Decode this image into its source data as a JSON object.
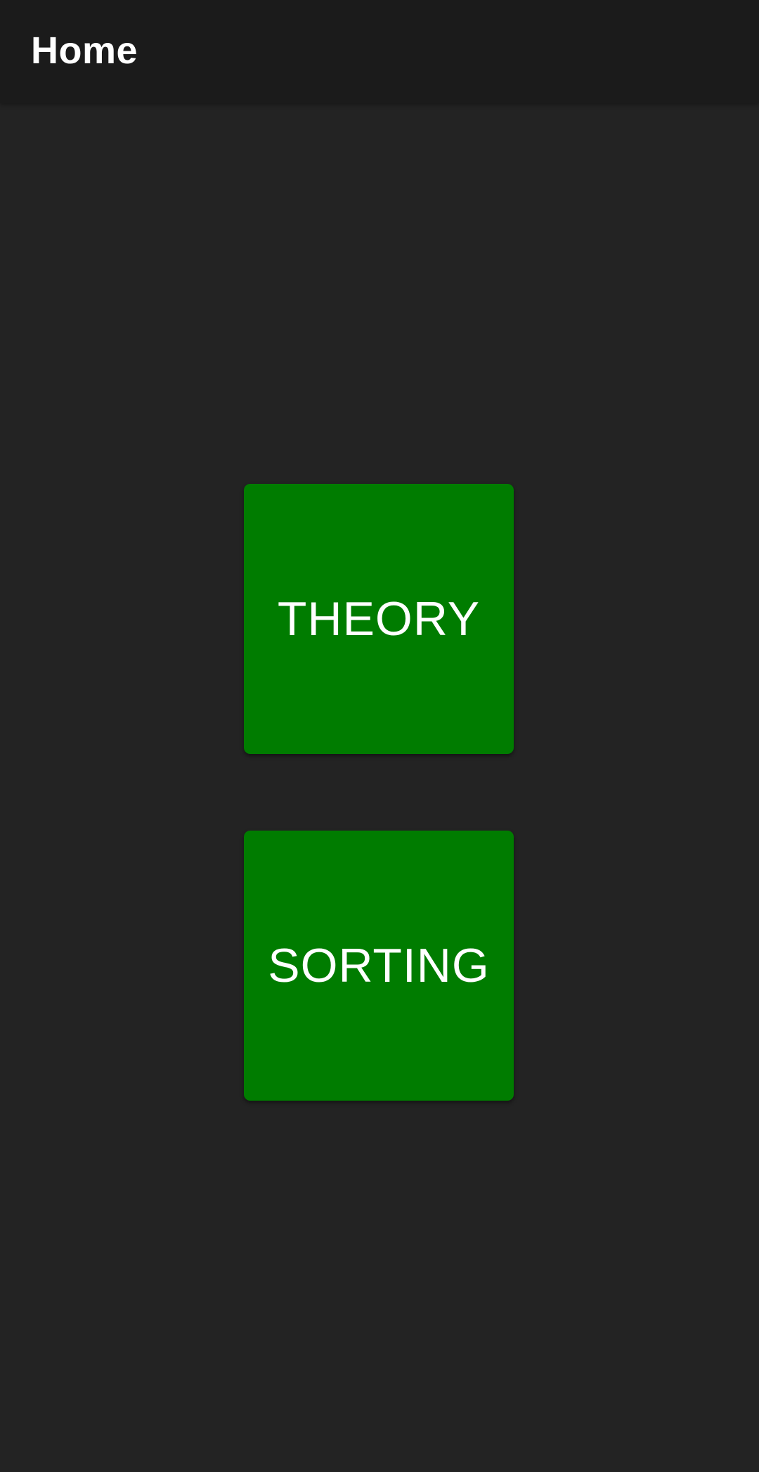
{
  "app_bar": {
    "title": "Home"
  },
  "main": {
    "buttons": [
      {
        "label": "THEORY"
      },
      {
        "label": "SORTING"
      }
    ]
  },
  "colors": {
    "background": "#232323",
    "app_bar": "#1b1b1b",
    "button": "#007c00",
    "text": "#ffffff"
  }
}
